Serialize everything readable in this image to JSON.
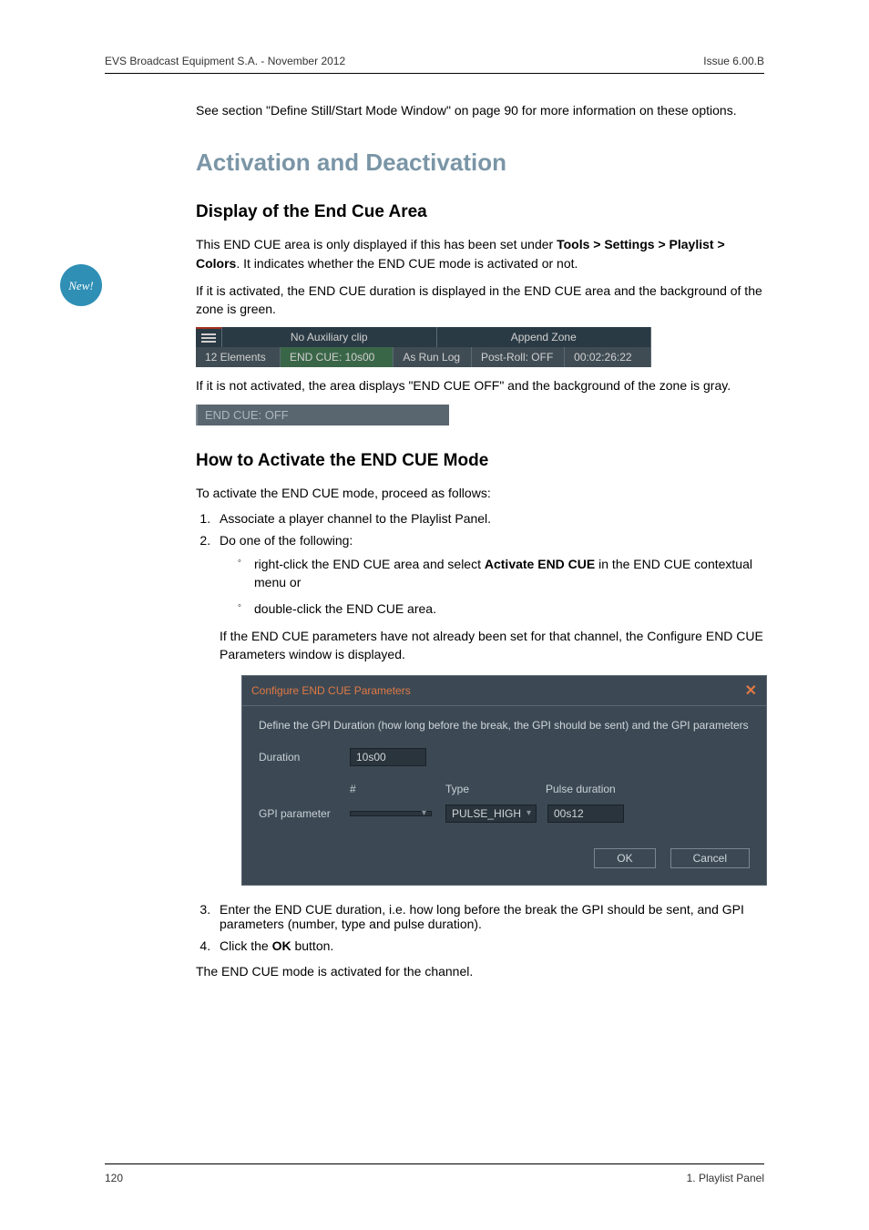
{
  "header": {
    "left": "EVS Broadcast Equipment S.A. - November 2012",
    "right": "Issue 6.00.B"
  },
  "intro": {
    "prefix": "See section \"Define Still/Start Mode Window\" on page 90 for more information on these options."
  },
  "h1": "Activation and Deactivation",
  "section1": {
    "title": "Display of the End Cue Area",
    "p1_a": "This END CUE area is only displayed if this has been set under ",
    "p1_b": "Tools > Settings > Playlist > Colors",
    "p1_c": ". It indicates whether the END CUE mode is activated or not.",
    "p2": "If it is activated, the END CUE duration is displayed in the END CUE area and the background of the zone is green.",
    "statusbar": {
      "noaux": "No Auxiliary clip",
      "append": "Append Zone",
      "elements": "12 Elements",
      "endcue": "END CUE: 10s00",
      "asrun": "As Run Log",
      "postroll": "Post-Roll: OFF",
      "timecode": "00:02:26:22"
    },
    "p3": "If it is not activated, the area displays \"END CUE OFF\" and the background of the zone is gray.",
    "offbar": "END CUE: OFF"
  },
  "section2": {
    "title": "How to Activate the END CUE Mode",
    "intro": "To activate the END CUE mode, proceed as follows:",
    "step1": "Associate a player channel to the Playlist Panel.",
    "step2": "Do one of the following:",
    "step2a_a": "right-click the END CUE area and select ",
    "step2a_b": "Activate END CUE",
    "step2a_c": " in the END CUE contextual menu or",
    "step2b": "double-click the END CUE area.",
    "step2_after": "If the END CUE parameters have not already been set for that channel, the Configure END CUE Parameters window is displayed.",
    "step3": "Enter the END CUE duration, i.e. how long before the break the GPI should be sent, and GPI parameters (number, type and pulse duration).",
    "step4_a": "Click the ",
    "step4_b": "OK",
    "step4_c": " button.",
    "outro": "The END CUE mode is activated for the channel."
  },
  "dialog": {
    "title": "Configure END CUE Parameters",
    "descr": "Define the GPI Duration (how long before the break, the GPI should be sent) and the GPI parameters",
    "duration_label": "Duration",
    "duration_value": "10s00",
    "hash": "#",
    "type_head": "Type",
    "pulse_head": "Pulse duration",
    "gpi_label": "GPI parameter",
    "gpi_number": "",
    "type_value": "PULSE_HIGH",
    "pulse_value": "00s12",
    "ok": "OK",
    "cancel": "Cancel"
  },
  "footer": {
    "left": "120",
    "right": "1. Playlist Panel"
  },
  "badge": "New!"
}
